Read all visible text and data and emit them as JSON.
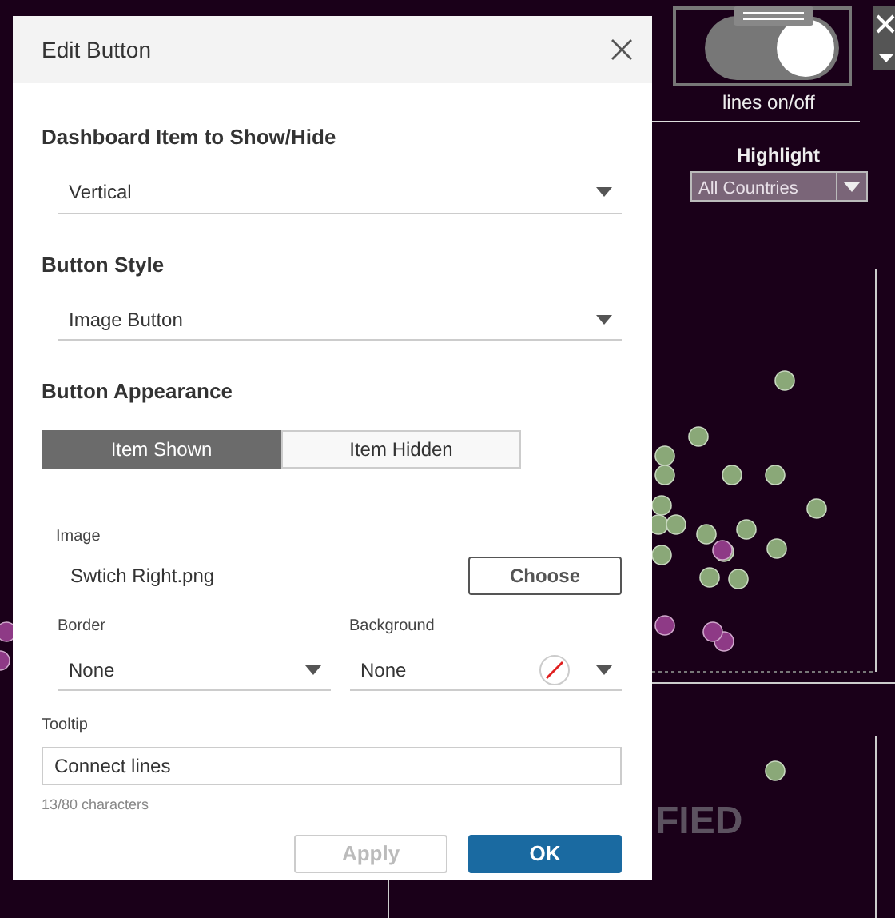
{
  "dashboard": {
    "toggle": {
      "on": true,
      "label": "lines on/off"
    },
    "highlight": {
      "label": "Highlight",
      "value": "All Countries"
    },
    "fragments": [
      "FIED"
    ]
  },
  "dialog": {
    "title": "Edit Button",
    "item_section": {
      "heading": "Dashboard Item to Show/Hide",
      "value": "Vertical"
    },
    "style_section": {
      "heading": "Button Style",
      "value": "Image Button"
    },
    "appearance_section": {
      "heading": "Button Appearance",
      "tabs": [
        {
          "label": "Item Shown",
          "selected": true
        },
        {
          "label": "Item Hidden",
          "selected": false
        }
      ],
      "image": {
        "label": "Image",
        "file": "Swtich Right.png",
        "button": "Choose"
      },
      "border": {
        "label": "Border",
        "value": "None"
      },
      "background": {
        "label": "Background",
        "value": "None"
      }
    },
    "tooltip": {
      "label": "Tooltip",
      "value": "Connect lines",
      "count": "13/80 characters"
    },
    "buttons": [
      {
        "label": "Apply",
        "disabled": true,
        "kind": "secondary"
      },
      {
        "label": "OK",
        "disabled": false,
        "kind": "primary"
      }
    ]
  }
}
